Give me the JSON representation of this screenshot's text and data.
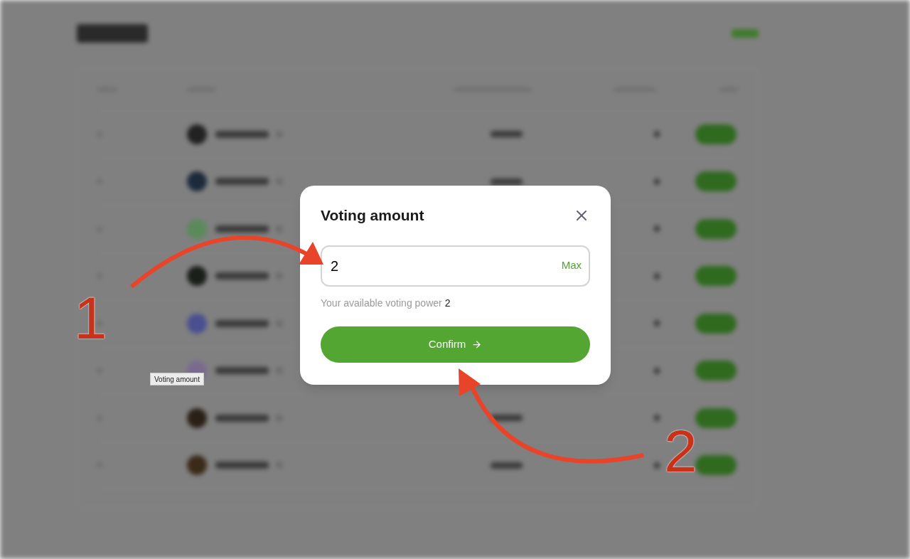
{
  "dialog": {
    "title": "Voting amount",
    "amount_field": {
      "value": "2",
      "max_label": "Max"
    },
    "available": {
      "label": "Your available voting power",
      "value": "2"
    },
    "confirm_button": {
      "label": "Confirm"
    }
  },
  "tooltip": "Voting amount",
  "annotations": [
    {
      "label": "1"
    },
    {
      "label": "2"
    }
  ]
}
